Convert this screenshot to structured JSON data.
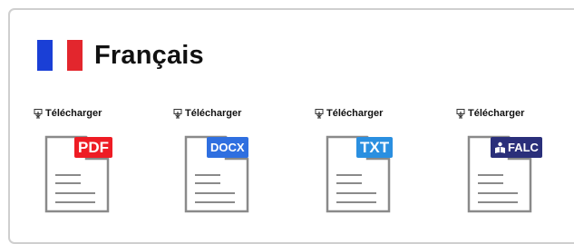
{
  "section": {
    "title": "Français",
    "flag_colors": [
      "#1a3fd6",
      "#ffffff",
      "#e3262d"
    ]
  },
  "downloads": [
    {
      "label": "Télécharger",
      "format": "PDF",
      "badge_color": "#ee1c24",
      "icon": "download-icon"
    },
    {
      "label": "Télécharger",
      "format": "DOCX",
      "badge_color": "#2f6fe0",
      "icon": "download-icon"
    },
    {
      "label": "Télécharger",
      "format": "TXT",
      "badge_color": "#2a8fe0",
      "icon": "download-icon"
    },
    {
      "label": "Télécharger",
      "format": "FALC",
      "badge_color": "#2a2f7a",
      "icon": "download-icon"
    }
  ]
}
